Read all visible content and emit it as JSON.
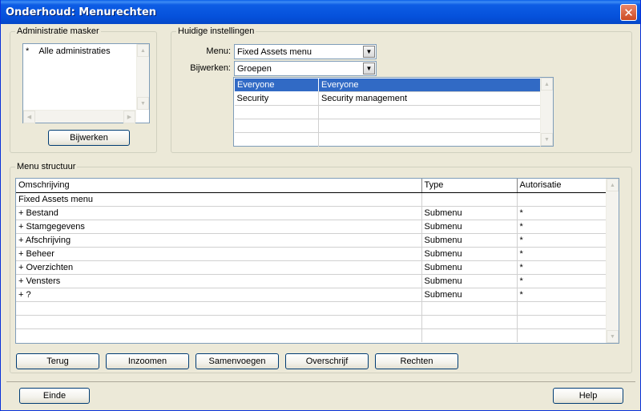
{
  "window": {
    "title": "Onderhoud: Menurechten"
  },
  "admin_mask": {
    "legend": "Administratie masker",
    "items": [
      {
        "code": "*",
        "label": "Alle administraties"
      }
    ],
    "update_button": "Bijwerken"
  },
  "settings": {
    "legend": "Huidige instellingen",
    "menu_label": "Menu:",
    "menu_value": "Fixed Assets menu",
    "update_label": "Bijwerken:",
    "update_value": "Groepen",
    "groups": [
      {
        "name": "Everyone",
        "description": "Everyone"
      },
      {
        "name": "Security",
        "description": "Security management"
      }
    ]
  },
  "menu_structure": {
    "legend": "Menu structuur",
    "headers": {
      "description": "Omschrijving",
      "type": "Type",
      "authorization": "Autorisatie"
    },
    "rows": [
      {
        "description": "Fixed Assets menu",
        "type": "",
        "authorization": ""
      },
      {
        "description": "+ Bestand",
        "type": "Submenu",
        "authorization": "*"
      },
      {
        "description": "+ Stamgegevens",
        "type": "Submenu",
        "authorization": "*"
      },
      {
        "description": "+ Afschrijving",
        "type": "Submenu",
        "authorization": "*"
      },
      {
        "description": "+ Beheer",
        "type": "Submenu",
        "authorization": "*"
      },
      {
        "description": "+ Overzichten",
        "type": "Submenu",
        "authorization": "*"
      },
      {
        "description": "+ Vensters",
        "type": "Submenu",
        "authorization": "*"
      },
      {
        "description": "+ ?",
        "type": "Submenu",
        "authorization": "*"
      }
    ]
  },
  "actions": {
    "back": "Terug",
    "zoom": "Inzoomen",
    "merge": "Samenvoegen",
    "overwrite": "Overschrijf",
    "rights": "Rechten"
  },
  "footer": {
    "close": "Einde",
    "help": "Help"
  }
}
